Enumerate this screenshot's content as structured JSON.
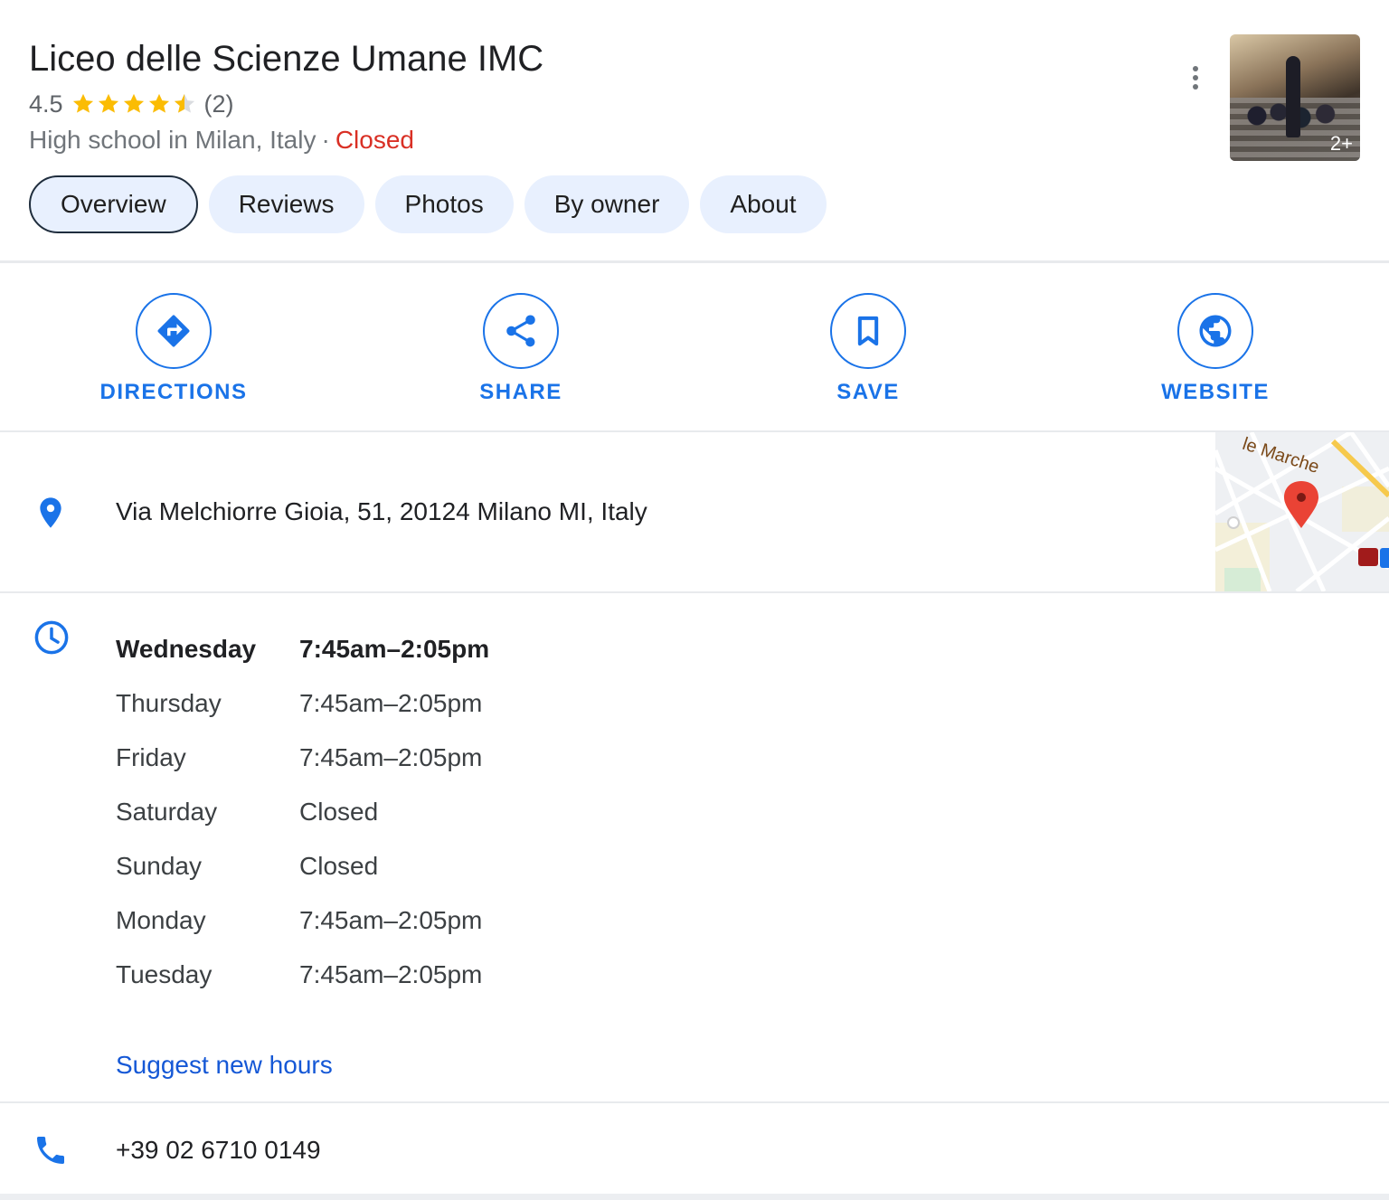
{
  "place": {
    "title": "Liceo delle Scienze Umane IMC",
    "rating": "4.5",
    "rating_value": 4.5,
    "review_count": "(2)",
    "category": "High school in Milan, Italy",
    "separator": "·",
    "status": "Closed",
    "status_color": "#d93025",
    "photo_count": "2+"
  },
  "tabs": [
    {
      "label": "Overview",
      "active": true
    },
    {
      "label": "Reviews",
      "active": false
    },
    {
      "label": "Photos",
      "active": false
    },
    {
      "label": "By owner",
      "active": false
    },
    {
      "label": "About",
      "active": false
    }
  ],
  "actions": [
    {
      "label": "DIRECTIONS",
      "icon": "directions-icon"
    },
    {
      "label": "SHARE",
      "icon": "share-icon"
    },
    {
      "label": "SAVE",
      "icon": "bookmark-icon"
    },
    {
      "label": "WEBSITE",
      "icon": "globe-icon"
    }
  ],
  "address": {
    "text": "Via Melchiorre Gioia, 51, 20124 Milano MI, Italy",
    "icon": "location-pin-icon",
    "map_label": "le Marche"
  },
  "hours": {
    "icon": "clock-icon",
    "rows": [
      {
        "day": "Wednesday",
        "time": "7:45am–2:05pm"
      },
      {
        "day": "Thursday",
        "time": "7:45am–2:05pm"
      },
      {
        "day": "Friday",
        "time": "7:45am–2:05pm"
      },
      {
        "day": "Saturday",
        "time": "Closed"
      },
      {
        "day": "Sunday",
        "time": "Closed"
      },
      {
        "day": "Monday",
        "time": "7:45am–2:05pm"
      },
      {
        "day": "Tuesday",
        "time": "7:45am–2:05pm"
      }
    ],
    "suggest_label": "Suggest new hours"
  },
  "phone": {
    "number": "+39 02 6710 0149",
    "icon": "phone-icon"
  },
  "colors": {
    "accent": "#1a73e8",
    "star": "#fbbc04",
    "tab_bg": "#e8f0fe",
    "link": "#1558d6"
  }
}
